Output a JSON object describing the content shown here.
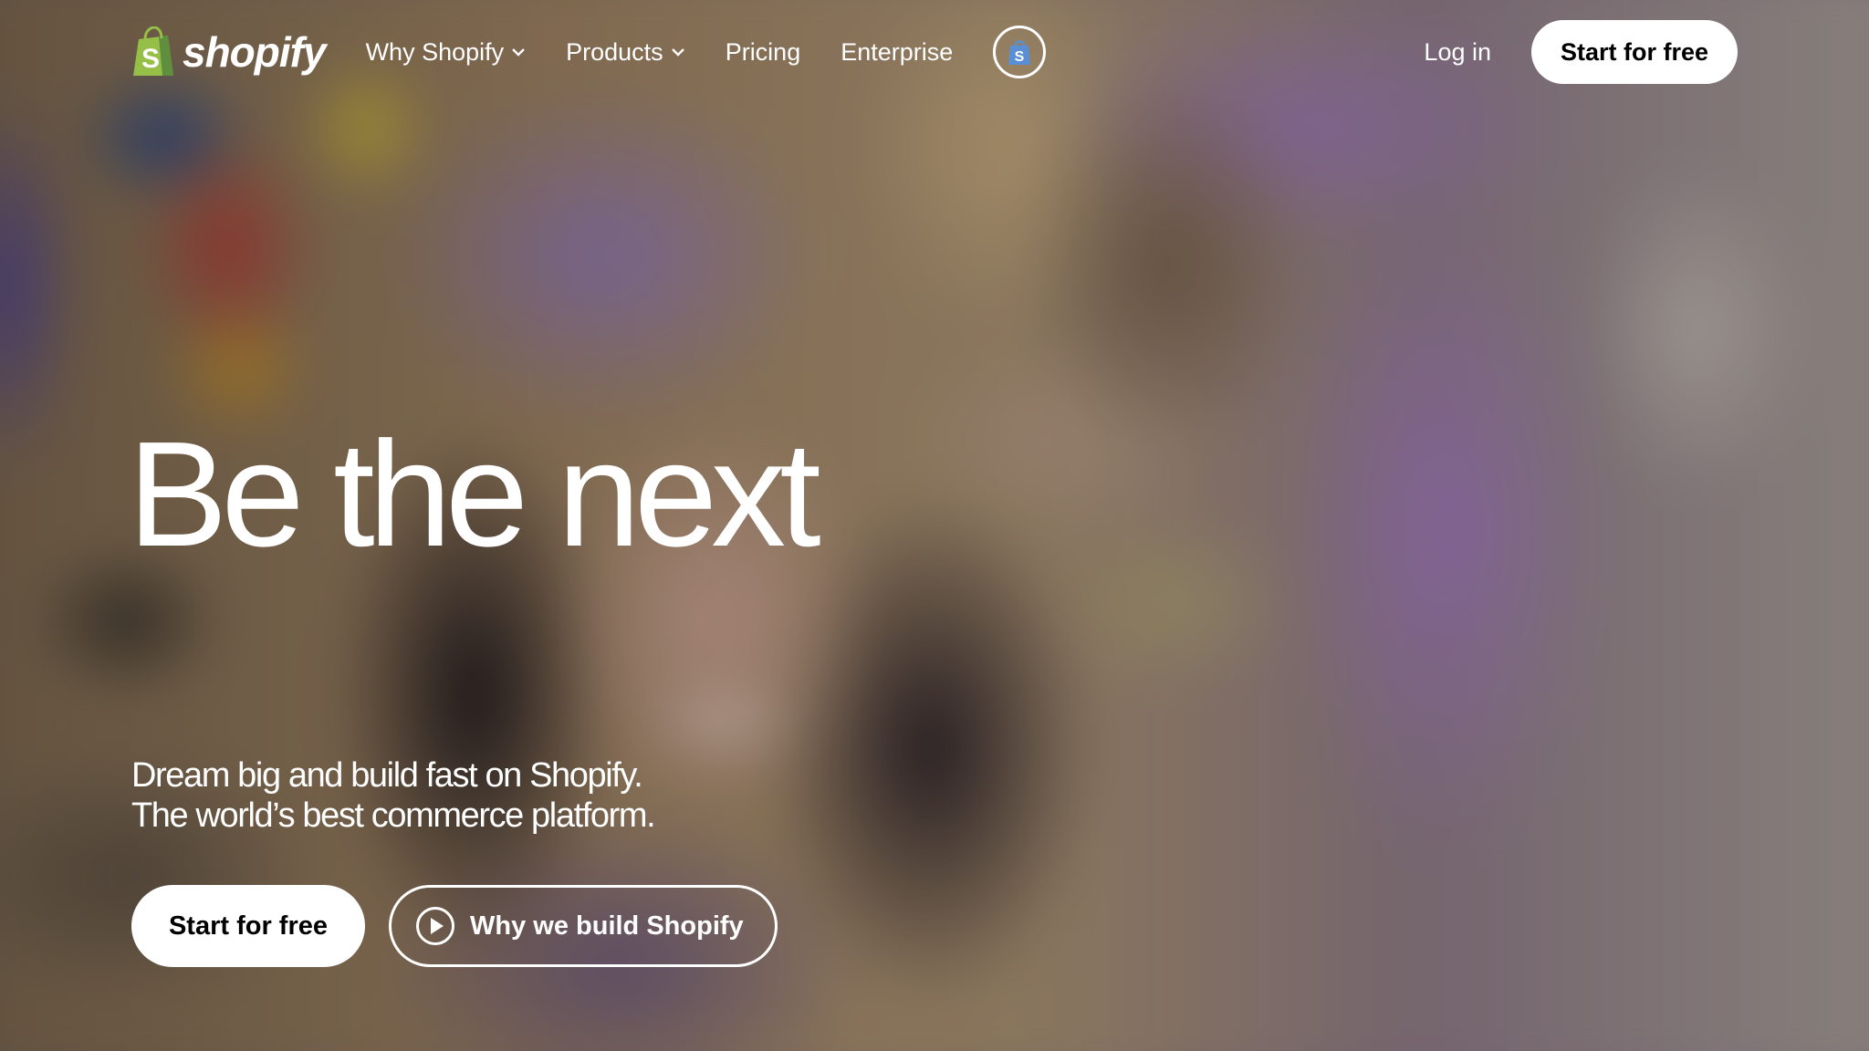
{
  "brand": {
    "name": "shopify",
    "logo_icon": "shopify-bag-icon",
    "logo_green": "#95bf47"
  },
  "nav": {
    "items": [
      {
        "label": "Why Shopify",
        "has_dropdown": true
      },
      {
        "label": "Products",
        "has_dropdown": true
      },
      {
        "label": "Pricing",
        "has_dropdown": false
      },
      {
        "label": "Enterprise",
        "has_dropdown": false
      }
    ],
    "shop_icon": "shop-app-icon",
    "login_label": "Log in",
    "cta_label": "Start for free"
  },
  "hero": {
    "headline": "Be the next",
    "subline_1": "Dream big and build fast on Shopify.",
    "subline_2": "The world’s best commerce platform.",
    "primary_cta": "Start for free",
    "secondary_cta": "Why we build Shopify",
    "secondary_icon": "play-icon"
  },
  "colors": {
    "text": "#ffffff",
    "button_bg": "#ffffff",
    "button_text": "#000000"
  }
}
